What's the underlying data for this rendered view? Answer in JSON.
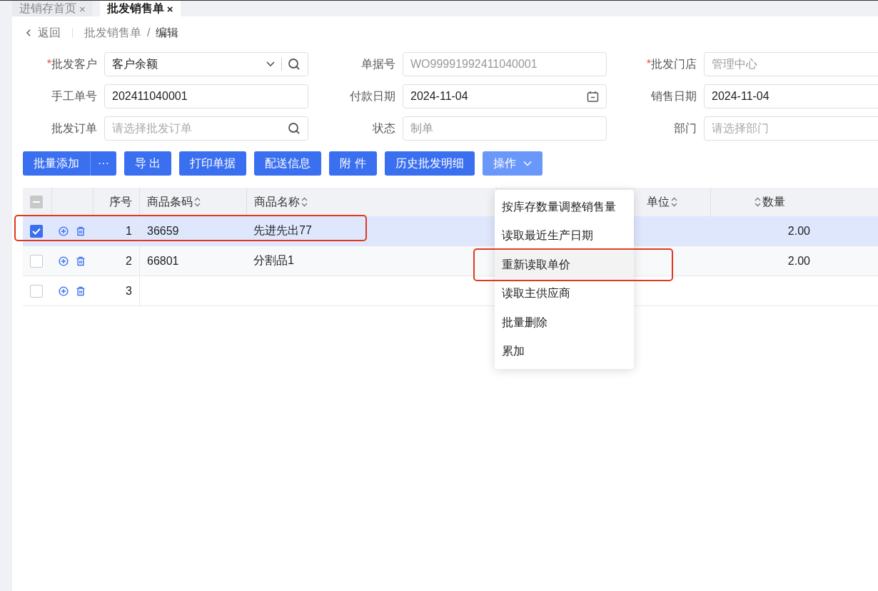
{
  "tabs": [
    {
      "label": "进销存首页",
      "close": "×",
      "selected": false
    },
    {
      "label": "批发销售单",
      "close": "×",
      "selected": true
    }
  ],
  "breadcrumb": {
    "back": "返回",
    "parent": "批发销售单",
    "separator": "/",
    "current": "编辑"
  },
  "form": [
    {
      "mark": "*",
      "label": "批发客户",
      "value": "客户余额",
      "kind": "select-search"
    },
    {
      "label": "单据号",
      "value": "WO99991992411040001",
      "kind": "text",
      "readonly": true
    },
    {
      "mark": "*",
      "label": "批发门店",
      "value": "管理中心",
      "kind": "text",
      "readonly": true
    },
    {
      "label": "手工单号",
      "value": "202411040001",
      "kind": "text"
    },
    {
      "label": "付款日期",
      "value": "2024-11-04",
      "kind": "date"
    },
    {
      "label": "销售日期",
      "value": "2024-11-04",
      "kind": "text"
    },
    {
      "label": "批发订单",
      "placeholder": "请选择批发订单",
      "kind": "search"
    },
    {
      "label": "状态",
      "value": "制单",
      "kind": "text",
      "readonly": true
    },
    {
      "label": "部门",
      "placeholder": "请选择部门",
      "kind": "text"
    }
  ],
  "toolbar": [
    {
      "label": "批量添加",
      "more": "···"
    },
    {
      "label": "导 出"
    },
    {
      "label": "打印单据"
    },
    {
      "label": "配送信息"
    },
    {
      "label": "附 件"
    },
    {
      "label": "历史批发明细"
    },
    {
      "label": "操作",
      "dropdown": true,
      "open": true
    }
  ],
  "table": {
    "header_checkbox": {
      "indeterminate": true
    },
    "columns": [
      {
        "label": "序号"
      },
      {
        "label": "商品条码",
        "sortable": true
      },
      {
        "label": "商品名称",
        "sortable": true
      },
      {
        "label": "单位",
        "sortable": true
      },
      {
        "label": "数量",
        "sortable": true
      }
    ],
    "rows": [
      {
        "selected": true,
        "annotated": true,
        "index": "1",
        "barcode": "36659",
        "name": "先进先出77",
        "quantity": "2.00"
      },
      {
        "selected": false,
        "index": "2",
        "barcode": "66801",
        "name": "分割品1",
        "quantity": "2.00"
      },
      {
        "selected": false,
        "index": "3"
      }
    ]
  },
  "menu": [
    {
      "label": "按库存数量调整销售量",
      "hovered": false
    },
    {
      "label": "读取最近生产日期",
      "hovered": false
    },
    {
      "label": "重新读取单价",
      "hovered": true,
      "annotated": true
    },
    {
      "label": "读取主供应商",
      "hovered": false
    },
    {
      "label": "批量删除",
      "hovered": false
    },
    {
      "label": "累加",
      "hovered": false
    }
  ]
}
